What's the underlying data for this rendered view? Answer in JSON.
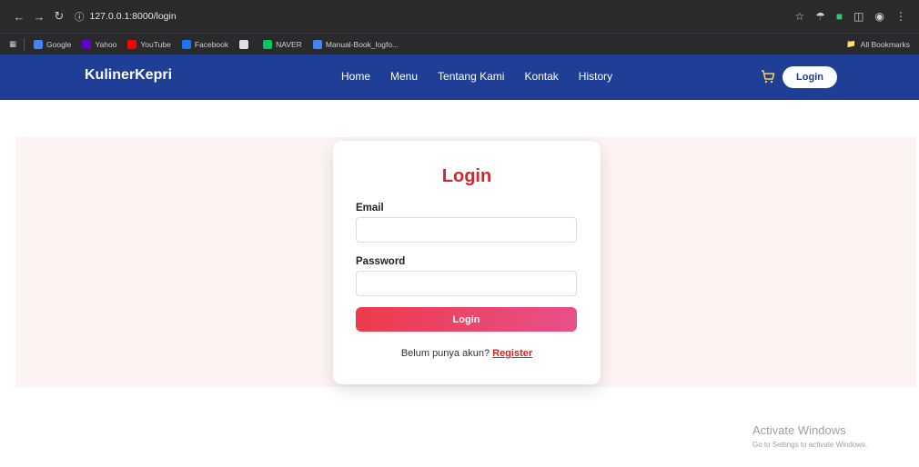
{
  "browser": {
    "url": "127.0.0.1:8000/login",
    "bookmarks": [
      {
        "label": "Google",
        "color": "#4285f4"
      },
      {
        "label": "Yahoo",
        "color": "#6001d2"
      },
      {
        "label": "YouTube",
        "color": "#ff0000"
      },
      {
        "label": "Facebook",
        "color": "#1877f2"
      },
      {
        "label": "",
        "color": "#e0e0e0"
      },
      {
        "label": "NAVER",
        "color": "#03c75a"
      },
      {
        "label": "Manual-Book_logfo...",
        "color": "#4285f4"
      }
    ],
    "all_bookmarks": "All Bookmarks"
  },
  "site": {
    "brand": "KulinerKepri",
    "menu": [
      "Home",
      "Menu",
      "Tentang Kami",
      "Kontak",
      "History"
    ],
    "login_button": "Login",
    "colors": {
      "navbar": "#1f3e95",
      "title": "#d0282e"
    }
  },
  "login_form": {
    "title": "Login",
    "email_label": "Email",
    "email_value": "",
    "password_label": "Password",
    "password_value": "",
    "submit_label": "Login",
    "register_prompt": "Belum punya akun?",
    "register_link": "Register"
  },
  "watermark": {
    "title": "Activate Windows",
    "subtitle": "Go to Settings to activate Windows."
  }
}
